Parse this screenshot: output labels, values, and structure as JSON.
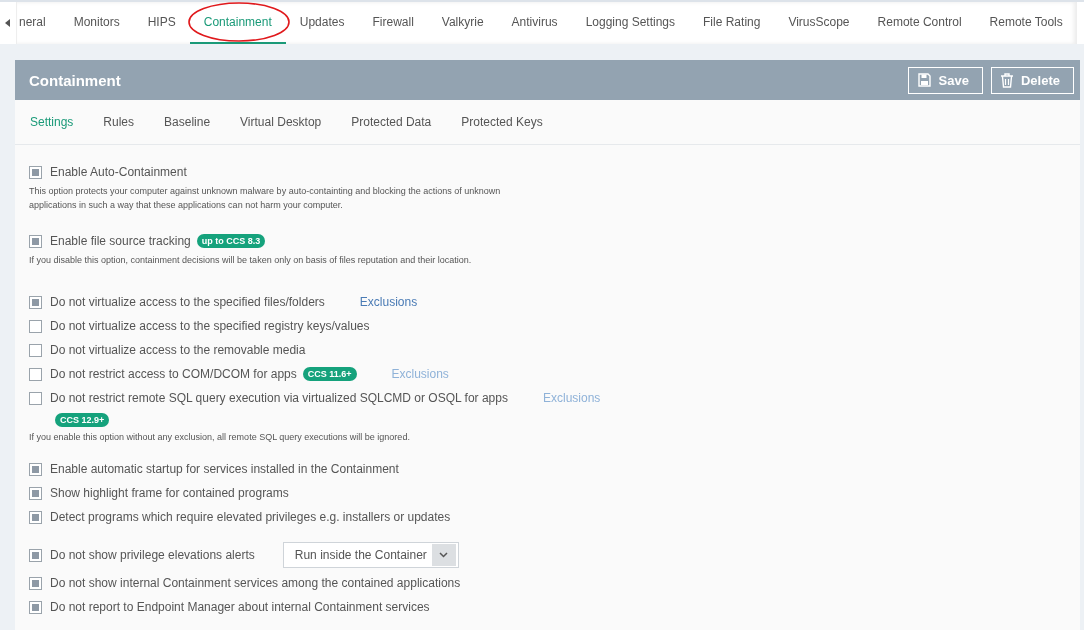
{
  "top_tabs": [
    {
      "label": "neral",
      "selected": false,
      "circled": false
    },
    {
      "label": "Monitors",
      "selected": false,
      "circled": false
    },
    {
      "label": "HIPS",
      "selected": false,
      "circled": false
    },
    {
      "label": "Containment",
      "selected": true,
      "circled": true
    },
    {
      "label": "Updates",
      "selected": false,
      "circled": false
    },
    {
      "label": "Firewall",
      "selected": false,
      "circled": false
    },
    {
      "label": "Valkyrie",
      "selected": false,
      "circled": false
    },
    {
      "label": "Antivirus",
      "selected": false,
      "circled": false
    },
    {
      "label": "Logging Settings",
      "selected": false,
      "circled": false
    },
    {
      "label": "File Rating",
      "selected": false,
      "circled": false
    },
    {
      "label": "VirusScope",
      "selected": false,
      "circled": false
    },
    {
      "label": "Remote Control",
      "selected": false,
      "circled": false
    },
    {
      "label": "Remote Tools",
      "selected": false,
      "circled": false
    }
  ],
  "panel": {
    "title": "Containment",
    "buttons": [
      {
        "label": "Save",
        "kind": "save"
      },
      {
        "label": "Delete",
        "kind": "delete"
      }
    ]
  },
  "sub_tabs": [
    {
      "label": "Settings",
      "selected": true
    },
    {
      "label": "Rules",
      "selected": false
    },
    {
      "label": "Baseline",
      "selected": false
    },
    {
      "label": "Virtual Desktop",
      "selected": false
    },
    {
      "label": "Protected Data",
      "selected": false
    },
    {
      "label": "Protected Keys",
      "selected": false
    }
  ],
  "groups": [
    {
      "options": [
        {
          "label": "Enable Auto-Containment",
          "checked": true,
          "note": "This option protects your computer against unknown malware by auto-containting and blocking the actions of unknown applications in such a way that these applications can not harm your computer."
        }
      ]
    },
    {
      "options": [
        {
          "label": "Enable file source tracking",
          "checked": true,
          "badge": "up to CCS 8.3",
          "note": "If you disable this option, containment decisions will be taken only on basis of files reputation and their location."
        }
      ]
    },
    {
      "options": [
        {
          "label": "Do not virtualize access to the specified files/folders",
          "checked": true,
          "link": {
            "text": "Exclusions",
            "disabled": false
          }
        },
        {
          "label": "Do not virtualize access to the specified registry keys/values",
          "checked": false
        },
        {
          "label": "Do not virtualize access to the removable media",
          "checked": false
        },
        {
          "label": "Do not restrict access to COM/DCOM for apps",
          "checked": false,
          "badge": "CCS 11.6+",
          "link": {
            "text": "Exclusions",
            "disabled": true
          }
        },
        {
          "label": "Do not restrict remote SQL query execution via virtualized SQLCMD or OSQL for apps",
          "checked": false,
          "badge": "CCS 12.9+",
          "badge_below": true,
          "link": {
            "text": "Exclusions",
            "disabled": true
          },
          "note": "If you enable this option without any exclusion, all remote SQL query executions will be ignored."
        }
      ]
    },
    {
      "options": [
        {
          "label": "Enable automatic startup for services installed in the Containment",
          "checked": true
        },
        {
          "label": "Show highlight frame for contained programs",
          "checked": true
        },
        {
          "label": "Detect programs which require elevated privileges e.g. installers or updates",
          "checked": true
        }
      ]
    },
    {
      "options": [
        {
          "label": "Do not show privilege elevations alerts",
          "checked": true,
          "select": {
            "value": "Run inside the Container"
          }
        },
        {
          "label": "Do not show internal Containment services among the contained applications",
          "checked": true
        },
        {
          "label": "Do not report to Endpoint Manager about internal Containment services",
          "checked": true
        }
      ]
    }
  ]
}
